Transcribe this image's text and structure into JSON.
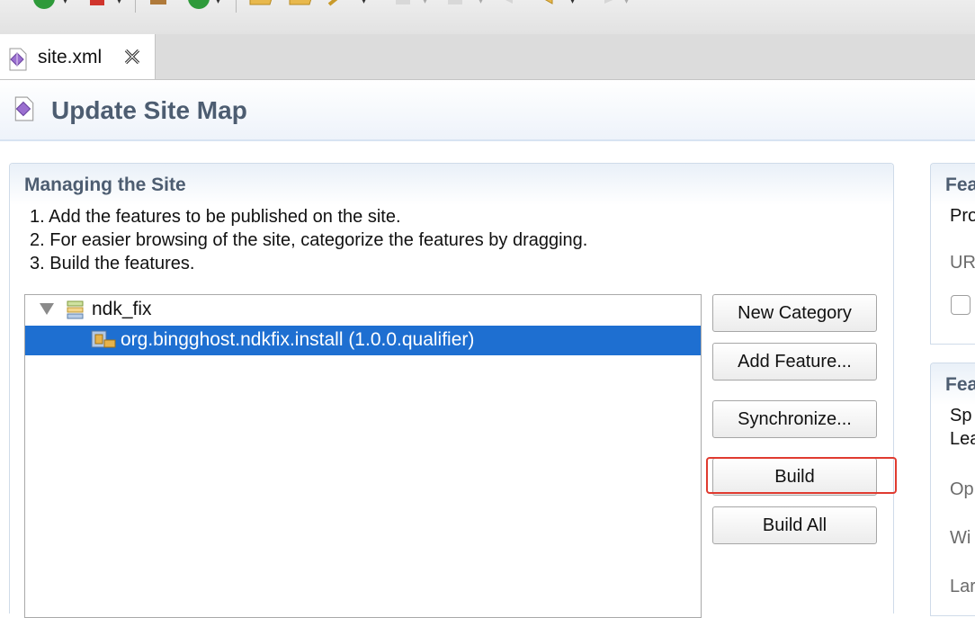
{
  "editor_tab": {
    "label": "site.xml"
  },
  "form": {
    "title": "Update Site Map"
  },
  "managing": {
    "title": "Managing the Site",
    "steps": [
      "1. Add the features to be published on the site.",
      "2. For easier browsing of the site, categorize the features by dragging.",
      "3. Build the features."
    ]
  },
  "tree": {
    "category": "ndk_fix",
    "feature": "org.bingghost.ndkfix.install (1.0.0.qualifier)"
  },
  "buttons": {
    "new_category": "New Category",
    "add_feature": "Add Feature...",
    "synchronize": "Synchronize...",
    "build": "Build",
    "build_all": "Build All"
  },
  "right_panel": {
    "section1_title": "Fea",
    "section1_line1": "Pro",
    "section1_line2": "UR",
    "section2_title": "Fea",
    "section2_line1": "Sp",
    "section2_line2": "Lea",
    "section2_line3": "Op",
    "section2_line4": "Wi",
    "section2_line5": "Lar"
  },
  "colors": {
    "selection": "#1e6fd1",
    "highlight": "#e03b30",
    "section_title": "#4d5d71"
  }
}
